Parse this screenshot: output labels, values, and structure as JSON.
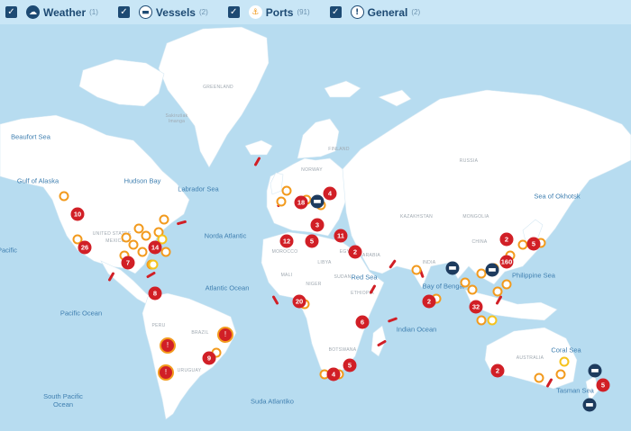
{
  "filters": [
    {
      "label": "Weather",
      "count": "(1)",
      "icon": "weather-icon",
      "color": "#1d4a73"
    },
    {
      "label": "Vessels",
      "count": "(2)",
      "icon": "vessel-icon",
      "color": "#1d4a73"
    },
    {
      "label": "Ports",
      "count": "(91)",
      "icon": "port-icon",
      "color": "#f29a1d"
    },
    {
      "label": "General",
      "count": "(2)",
      "icon": "general-icon",
      "color": "#1d4a73"
    }
  ],
  "oceans": [
    "Beaufort Sea",
    "Gulf of Alaska",
    "Hudson Bay",
    "Labrador Sea",
    "Norda Atlantic",
    "Atlantic Ocean",
    "Pacific Ocean",
    "South Pacific Ocean",
    "Suda Atlantiko",
    "Indian Ocean",
    "Red Sea",
    "Bay of Bengal",
    "Philippine Sea",
    "Sea of Okhotsk",
    "Coral Sea",
    "Tasman Sea",
    "Pacific"
  ],
  "land_labels": [
    "GREENLAND",
    "Sakirutiak Imanga",
    "RUSSIA",
    "MONGOLIA",
    "CHINA",
    "KAZAKHSTAN",
    "INDIA",
    "EGYPT",
    "LIBYA",
    "MALI",
    "NIGER",
    "SUDAN",
    "ETHIOPIA",
    "BRAZIL",
    "PERU",
    "MEXICO",
    "URUGUAY",
    "BOTSWANA",
    "UNITED STATES",
    "NORWAY",
    "AUSTRALIA",
    "MOROCCO",
    "FINLAND",
    "ARABIA"
  ],
  "markers_numbers": [
    "4",
    "18",
    "10",
    "26",
    "14",
    "7",
    "12",
    "5",
    "3",
    "11",
    "2",
    "20",
    "6",
    "8",
    "9",
    "4",
    "5",
    "2",
    "32",
    "160",
    "2",
    "5",
    "2",
    "5"
  ],
  "colors": {
    "water": "#b7dcf0",
    "land": "#ffffff",
    "alert": "#d11f26",
    "port": "#f29a1d",
    "weather": "#f6c21b",
    "vessel": "#1d3b5e"
  }
}
